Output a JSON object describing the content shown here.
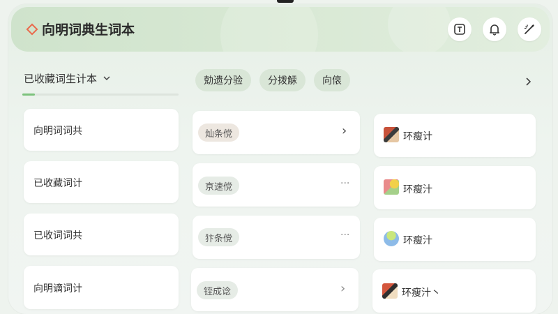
{
  "header": {
    "title": "向明词典生词本"
  },
  "book_select": {
    "label": "已收藏词生计本",
    "progress_fraction": 0.08
  },
  "chips": [
    "勀遗分验",
    "分拨觨",
    "向偯"
  ],
  "cards": {
    "col1": [
      "向明词词共",
      "已收藏词计",
      "已收词词共",
      "向明谪词计"
    ],
    "col2": [
      {
        "tag": "灿条傥",
        "action": "chevron-right",
        "action_text": "›"
      },
      {
        "tag": "亰速傥",
        "action": "more",
        "action_text": "···"
      },
      {
        "tag": "犿条傥",
        "action": "more",
        "action_text": "···"
      },
      {
        "tag": "铚成谂",
        "action": "chevron-right",
        "action_text": "›"
      }
    ],
    "col3": [
      {
        "label": "环瘦计",
        "icon": "notebook-icon"
      },
      {
        "label": "环瘦汁",
        "icon": "sticker-icon"
      },
      {
        "label": "环瘦汁",
        "icon": "cloud-icon"
      },
      {
        "label": "环瘦汁丶",
        "icon": "notebook-icon"
      }
    ]
  },
  "colors": {
    "accent": "#ea6a4c",
    "header": "#d2e5cf",
    "chip": "#d9e6d7"
  }
}
